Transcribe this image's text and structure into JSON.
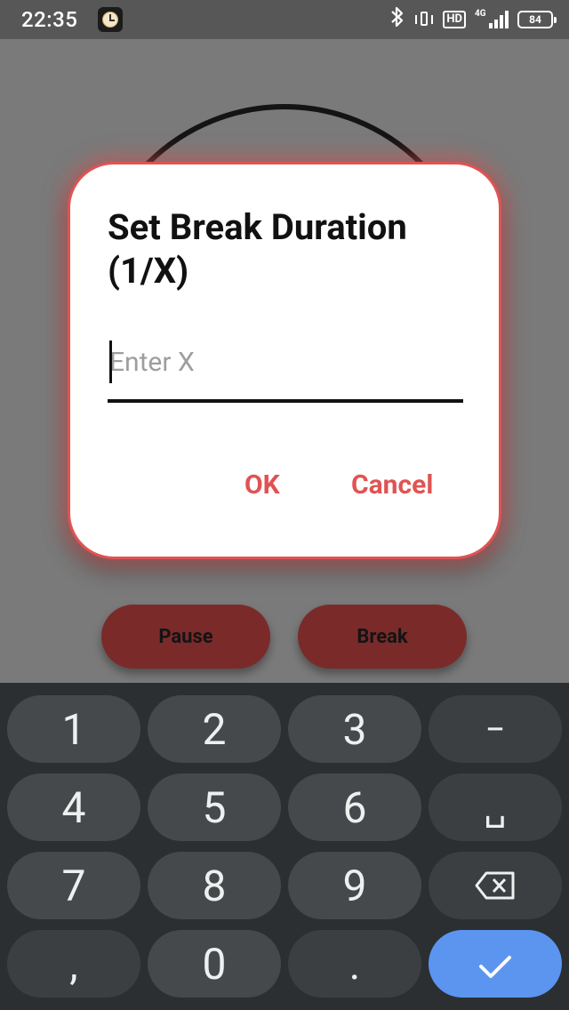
{
  "status_bar": {
    "time": "22:35",
    "app_icon": "clock-icon",
    "icons": [
      "bluetooth-icon",
      "vibrate-icon",
      "hd-icon",
      "signal-4g-icon",
      "battery-icon"
    ],
    "hd_label": "HD",
    "network_label": "4G",
    "battery_level": "84"
  },
  "background": {
    "pause_label": "Pause",
    "break_label": "Break"
  },
  "dialog": {
    "title": "Set Break Duration (1/X)",
    "input_value": "",
    "input_placeholder": "Enter X",
    "ok_label": "OK",
    "cancel_label": "Cancel",
    "accent_color": "#e05353"
  },
  "keyboard": {
    "row1": [
      "1",
      "2",
      "3",
      "−"
    ],
    "row2": [
      "4",
      "5",
      "6",
      "␣"
    ],
    "row3": [
      "7",
      "8",
      "9",
      "backspace-icon"
    ],
    "row4": [
      ",",
      "0",
      ".",
      "check-icon"
    ],
    "enter_color": "#5b95f0"
  }
}
